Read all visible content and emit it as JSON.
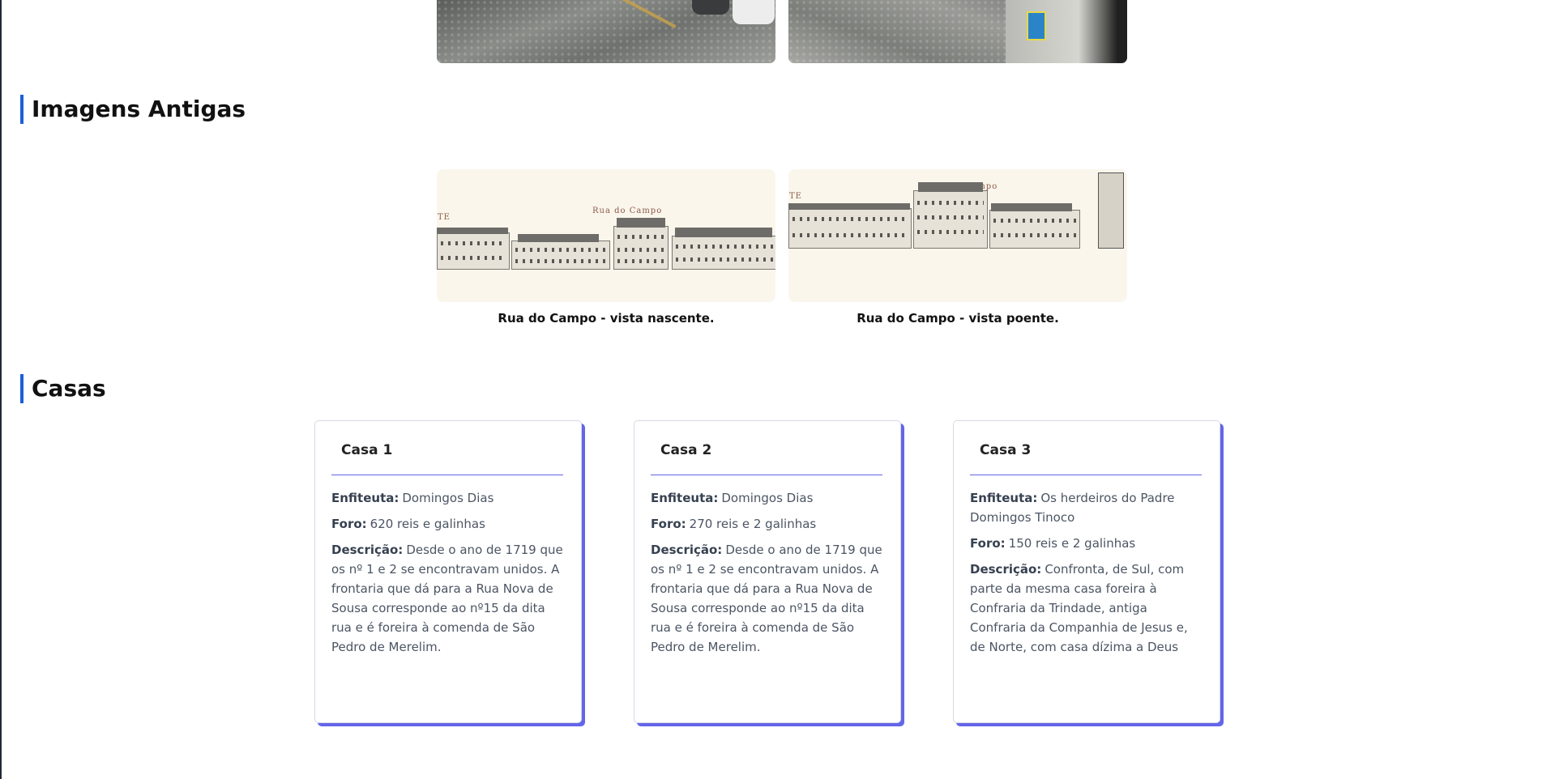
{
  "sections": {
    "old_images_title": "Imagens Antigas",
    "houses_title": "Casas"
  },
  "old_images": [
    {
      "caption": "Rua do Campo - vista nascente.",
      "drawing_label": "Rua do Campo",
      "edge_label": "TE"
    },
    {
      "caption": "Rua do Campo - vista poente.",
      "drawing_label": "Rua do Campo",
      "edge_label": "TE"
    }
  ],
  "labels": {
    "enfiteuta": "Enfiteuta:",
    "foro": "Foro:",
    "descricao": "Descrição:"
  },
  "houses": [
    {
      "title": "Casa 1",
      "enfiteuta": "Domingos Dias",
      "foro": "620 reis e galinhas",
      "descricao": "Desde o ano de 1719 que os nº 1 e 2 se encontravam unidos. A frontaria que dá para a Rua Nova de Sousa corresponde ao nº15 da dita rua e é foreira à comenda de São Pedro de Merelim."
    },
    {
      "title": "Casa 2",
      "enfiteuta": "Domingos Dias",
      "foro": "270 reis e 2 galinhas",
      "descricao": "Desde o ano de 1719 que os nº 1 e 2 se encontravam unidos. A frontaria que dá para a Rua Nova de Sousa corresponde ao nº15 da dita rua e é foreira à comenda de São Pedro de Merelim."
    },
    {
      "title": "Casa 3",
      "enfiteuta": "Os herdeiros do Padre Domingos Tinoco",
      "foro": "150 reis e 2 galinhas",
      "descricao": "Confronta, de Sul, com parte da mesma casa foreira à Confraria da Trindade, antiga Confraria da Companhia de Jesus e, de Norte, com casa dízima a Deus"
    }
  ],
  "colors": {
    "accent": "#6366e8",
    "heading_bar": "#1d5fd6"
  }
}
